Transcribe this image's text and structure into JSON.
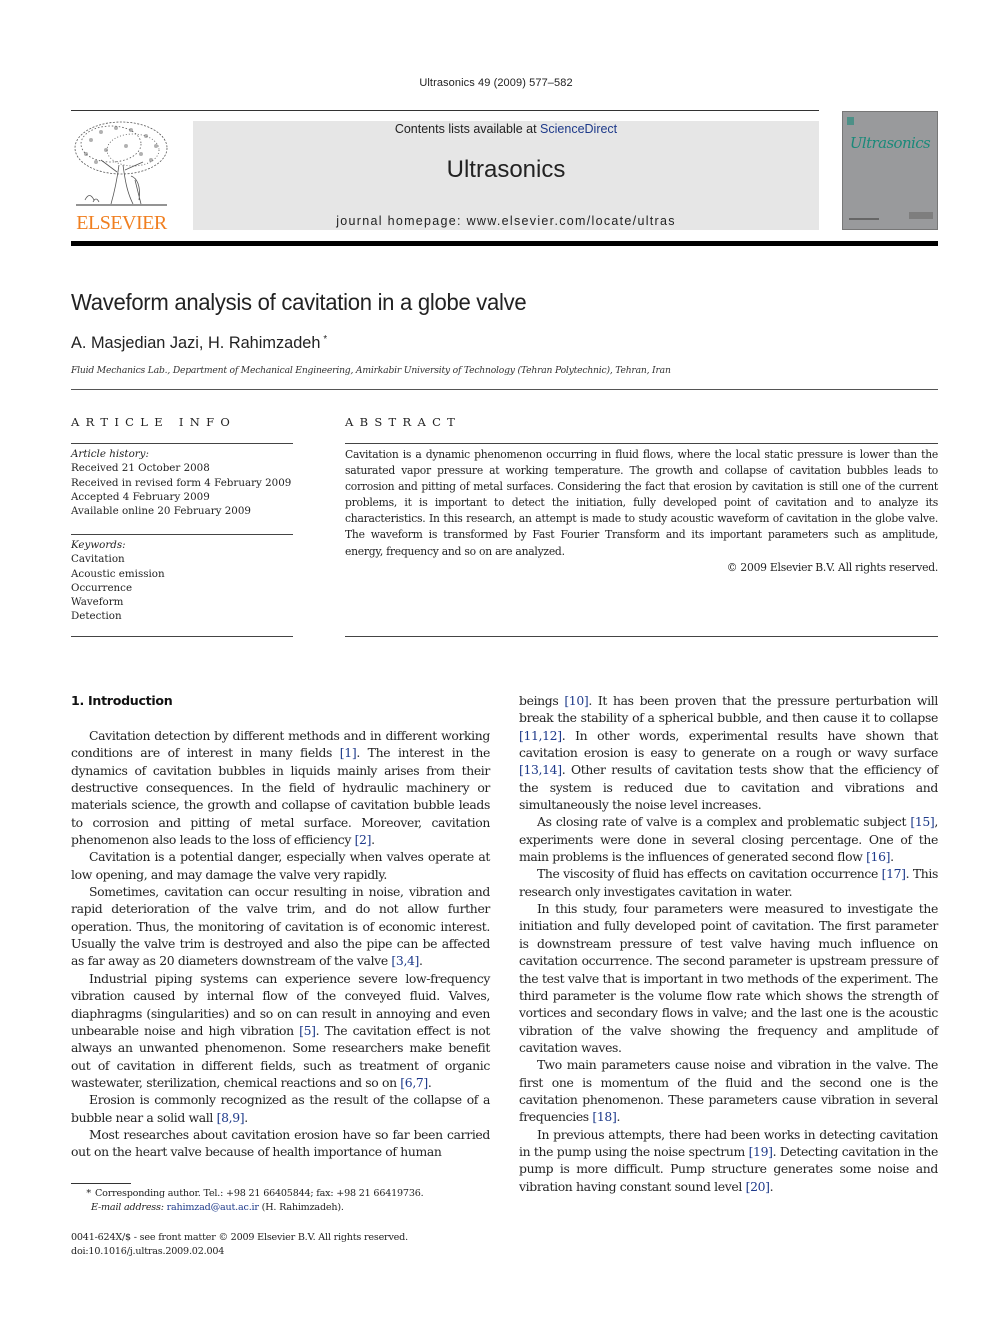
{
  "running_head": "Ultrasonics 49 (2009) 577–582",
  "masthead": {
    "publisher_logo_text": "ELSEVIER",
    "contents_prefix": "Contents lists available at ",
    "contents_link": "ScienceDirect",
    "journal_name": "Ultrasonics",
    "homepage": "journal homepage: www.elsevier.com/locate/ultras",
    "cover_title": "Ultrasonics",
    "colors": {
      "elsevier_orange": "#f07f20",
      "banner_bg": "#e6e6e6",
      "cover_bg": "#999a9c",
      "cover_title": "#1a8a7a",
      "link_blue": "#1e3a8a"
    }
  },
  "article": {
    "title": "Waveform analysis of cavitation in a globe valve",
    "authors": "A. Masjedian Jazi, H. Rahimzadeh",
    "author_mark": "*",
    "affiliation": "Fluid Mechanics Lab., Department of Mechanical Engineering, Amirkabir University of Technology (Tehran Polytechnic), Tehran, Iran"
  },
  "article_info": {
    "heading": "ARTICLE INFO",
    "history_label": "Article history:",
    "history": [
      "Received 21 October 2008",
      "Received in revised form 4 February 2009",
      "Accepted 4 February 2009",
      "Available online 20 February 2009"
    ],
    "keywords_label": "Keywords:",
    "keywords": [
      "Cavitation",
      "Acoustic emission",
      "Occurrence",
      "Waveform",
      "Detection"
    ]
  },
  "abstract": {
    "heading": "ABSTRACT",
    "text": "Cavitation is a dynamic phenomenon occurring in fluid flows, where the local static pressure is lower than the saturated vapor pressure at working temperature. The growth and collapse of cavitation bubbles leads to corrosion and pitting of metal surfaces. Considering the fact that erosion by cavitation is still one of the current problems, it is important to detect the initiation, fully developed point of cavitation and to analyze its characteristics. In this research, an attempt is made to study acoustic waveform of cavitation in the globe valve. The waveform is transformed by Fast Fourier Transform and its important parameters such as amplitude, energy, frequency and so on are analyzed.",
    "copyright": "© 2009 Elsevier B.V. All rights reserved."
  },
  "body": {
    "section_title": "1. Introduction",
    "left_paragraphs": [
      [
        {
          "t": "Cavitation detection by different methods and in different working conditions are of interest in many fields "
        },
        {
          "r": "[1]"
        },
        {
          "t": ". The interest in the dynamics of cavitation bubbles in liquids mainly arises from their destructive consequences. In the field of hydraulic machinery or materials science, the growth and collapse of cavitation bubble leads to corrosion and pitting of metal surface. Moreover, cavitation phenomenon also leads to the loss of efficiency "
        },
        {
          "r": "[2]"
        },
        {
          "t": "."
        }
      ],
      [
        {
          "t": "Cavitation is a potential danger, especially when valves operate at low opening, and may damage the valve very rapidly."
        }
      ],
      [
        {
          "t": "Sometimes, cavitation can occur resulting in noise, vibration and rapid deterioration of the valve trim, and do not allow further operation. Thus, the monitoring of cavitation is of economic interest. Usually the valve trim is destroyed and also the pipe can be affected as far away as 20 diameters downstream of the valve "
        },
        {
          "r": "[3,4]"
        },
        {
          "t": "."
        }
      ],
      [
        {
          "t": "Industrial piping systems can experience severe low-frequency vibration caused by internal flow of the conveyed fluid. Valves, diaphragms (singularities) and so on can result in annoying and even unbearable noise and high vibration "
        },
        {
          "r": "[5]"
        },
        {
          "t": ". The cavitation effect is not always an unwanted phenomenon. Some researchers make benefit out of cavitation in different fields, such as treatment of organic wastewater, sterilization, chemical reactions and so on "
        },
        {
          "r": "[6,7]"
        },
        {
          "t": "."
        }
      ],
      [
        {
          "t": "Erosion is commonly recognized as the result of the collapse of a bubble near a solid wall "
        },
        {
          "r": "[8,9]"
        },
        {
          "t": "."
        }
      ],
      [
        {
          "t": "Most researches about cavitation erosion have so far been carried out on the heart valve because of health importance of human"
        }
      ]
    ],
    "right_paragraphs": [
      [
        {
          "t": "beings "
        },
        {
          "r": "[10]"
        },
        {
          "t": ". It has been proven that the pressure perturbation will break the stability of a spherical bubble, and then cause it to collapse "
        },
        {
          "r": "[11,12]"
        },
        {
          "t": ". In other words, experimental results have shown that cavitation erosion is easy to generate on a rough or wavy surface "
        },
        {
          "r": "[13,14]"
        },
        {
          "t": ". Other results of cavitation tests show that the efficiency of the system is reduced due to cavitation and vibrations and simultaneously the noise level increases."
        }
      ],
      [
        {
          "t": "As closing rate of valve is a complex and problematic subject "
        },
        {
          "r": "[15]"
        },
        {
          "t": ", experiments were done in several closing percentage. One of the main problems is the influences of generated second flow "
        },
        {
          "r": "[16]"
        },
        {
          "t": "."
        }
      ],
      [
        {
          "t": "The viscosity of fluid has effects on cavitation occurrence "
        },
        {
          "r": "[17]"
        },
        {
          "t": ". This research only investigates cavitation in water."
        }
      ],
      [
        {
          "t": "In this study, four parameters were measured to investigate the initiation and fully developed point of cavitation. The first parameter is downstream pressure of test valve having much influence on cavitation occurrence. The second parameter is upstream pressure of the test valve that is important in two methods of the experiment. The third parameter is the volume flow rate which shows the strength of vortices and secondary flows in valve; and the last one is the acoustic vibration of the valve showing the frequency and amplitude of cavitation waves."
        }
      ],
      [
        {
          "t": "Two main parameters cause noise and vibration in the valve. The first one is momentum of the fluid and the second one is the cavitation phenomenon. These parameters cause vibration in several frequencies "
        },
        {
          "r": "[18]"
        },
        {
          "t": "."
        }
      ],
      [
        {
          "t": "In previous attempts, there had been works in detecting cavitation in the pump using the noise spectrum "
        },
        {
          "r": "[19]"
        },
        {
          "t": ". Detecting cavitation in the pump is more difficult. Pump structure generates some noise and vibration having constant sound level "
        },
        {
          "r": "[20]"
        },
        {
          "t": "."
        }
      ]
    ]
  },
  "footnote": {
    "mark": "*",
    "corresponding": "Corresponding author. Tel.: +98 21 66405844; fax: +98 21 66419736.",
    "email_label": "E-mail address:",
    "email": "rahimzad@aut.ac.ir",
    "email_suffix": " (H. Rahimzadeh)."
  },
  "issn_line": "0041-624X/$ - see front matter © 2009 Elsevier B.V. All rights reserved.",
  "doi_line": "doi:10.1016/j.ultras.2009.02.004"
}
